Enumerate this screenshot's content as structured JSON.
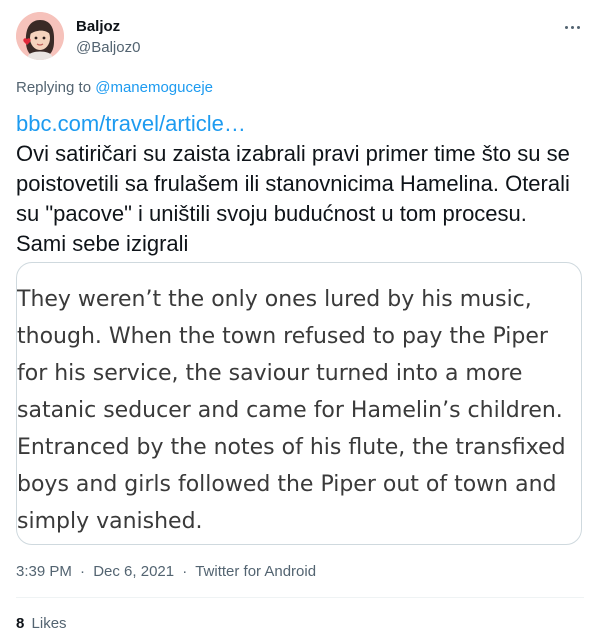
{
  "author": {
    "display_name": "Baljoz",
    "handle": "@Baljoz0"
  },
  "replying": {
    "prefix": "Replying to",
    "mention": "@manemoguceje"
  },
  "tweet": {
    "link_text": "bbc.com/travel/article…",
    "text": "Ovi satiričari su zaista izabrali pravi primer time što su se poistovetili sa frulašem ili stanovnicima Hamelina. Oterali su \"pacove\" i uništili svoju budućnost u tom procesu. Sami sebe izigrali"
  },
  "image_card": {
    "lines": [
      "They weren’t the only ones lured by his music,",
      "though. When the town refused to pay the Piper",
      "for his service, the saviour turned into a more",
      "satanic seducer and came for Hamelin’s children.",
      "Entranced by the notes of his flute, the transfixed",
      "boys and girls followed the Piper out of town and",
      "simply vanished."
    ]
  },
  "meta": {
    "time": "3:39 PM",
    "separator": "·",
    "date": "Dec 6, 2021",
    "source": "Twitter for Android"
  },
  "stats": {
    "likes_count": "8",
    "likes_label": "Likes"
  },
  "icons": {
    "more": "more-horizontal-icon",
    "avatar": "avatar-illustration"
  },
  "colors": {
    "link": "#1d9bf0",
    "secondary_text": "#536471",
    "primary_text": "#0f1419",
    "card_border": "#cfd9de"
  }
}
